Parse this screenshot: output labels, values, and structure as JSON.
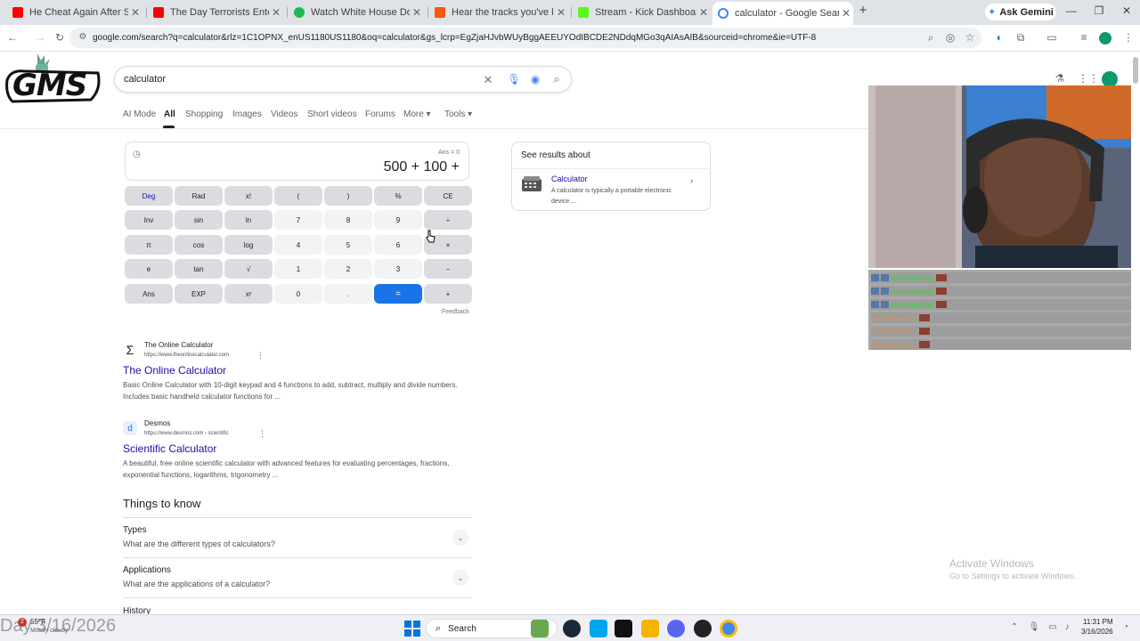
{
  "tabs": [
    {
      "title": "He Cheat Again After She",
      "icon": "youtube-icon",
      "color": "#ff0000"
    },
    {
      "title": "The Day Terrorists Entered the",
      "icon": "youtube-icon",
      "color": "#ff0000"
    },
    {
      "title": "Watch White House Down For",
      "icon": "play-icon",
      "color": "#1db954"
    },
    {
      "title": "Hear the tracks you've liked: on",
      "icon": "soundcloud-icon",
      "color": "#ff5500"
    },
    {
      "title": "Stream - Kick Dashboard",
      "icon": "kick-icon",
      "color": "#53fc18"
    },
    {
      "title": "calculator - Google Search",
      "icon": "google-icon",
      "color": "#4285f4"
    }
  ],
  "gemini_label": "Ask Gemini",
  "url": "google.com/search?q=calculator&rlz=1C1OPNX_enUS1180US1180&oq=calculator&gs_lcrp=EgZjaHJvbWUyBggAEEUYOdIBCDE2NDdqMGo3qAIAsAIB&sourceid=chrome&ie=UTF-8",
  "logo_text": "GMS",
  "search": {
    "query": "calculator"
  },
  "nav_tabs": [
    {
      "label": "AI Mode"
    },
    {
      "label": "All"
    },
    {
      "label": "Shopping"
    },
    {
      "label": "Images"
    },
    {
      "label": "Videos"
    },
    {
      "label": "Short videos"
    },
    {
      "label": "Forums"
    },
    {
      "label": "More ▾"
    },
    {
      "label": "Tools ▾"
    }
  ],
  "calculator": {
    "ans": "Ans = 0",
    "expression": "500 + 100 +",
    "keys": [
      [
        "Deg",
        "Rad",
        "x!",
        "(",
        ")",
        "%",
        "CE"
      ],
      [
        "Inv",
        "sin",
        "ln",
        "7",
        "8",
        "9",
        "÷"
      ],
      [
        "π",
        "cos",
        "log",
        "4",
        "5",
        "6",
        "×"
      ],
      [
        "e",
        "tan",
        "√",
        "1",
        "2",
        "3",
        "−"
      ],
      [
        "Ans",
        "EXP",
        "xʸ",
        "0",
        ".",
        "=",
        "+"
      ]
    ],
    "feedback": "Feedback"
  },
  "results": [
    {
      "site": "The Online Calculator",
      "url": "https://www.theonlinecalculator.com",
      "title": "The Online Calculator",
      "snippet": "Basic Online Calculator with 10-digit keypad and 4 functions to add, subtract, multiply and divide numbers. Includes basic handheld calculator functions for ..."
    },
    {
      "site": "Desmos",
      "url": "https://www.desmos.com › scientific",
      "title": "Scientific Calculator",
      "snippet": "A beautiful, free online scientific calculator with advanced features for evaluating percentages, fractions, exponential functions, logarithms, trigonometry ..."
    }
  ],
  "things_to_know": {
    "title": "Things to know",
    "items": [
      {
        "head": "Types",
        "question": "What are the different types of calculators?"
      },
      {
        "head": "Applications",
        "question": "What are the applications of a calculator?"
      },
      {
        "head": "History",
        "question": ""
      }
    ]
  },
  "side_panel": {
    "heading": "See results about",
    "title": "Calculator",
    "desc": "A calculator is typically a portable electronic device ..."
  },
  "chat": [
    {
      "user": "speakupdvng",
      "color": "#44cc44"
    },
    {
      "user": "speakupdvng",
      "color": "#44cc44"
    },
    {
      "user": "speakupdvng",
      "color": "#44cc44"
    },
    {
      "user": "punkstarmoee",
      "color": "#d89050"
    },
    {
      "user": "punkstarmoee",
      "color": "#d89050"
    },
    {
      "user": "punkstarmoee",
      "color": "#d89050"
    }
  ],
  "activate": {
    "title": "Activate Windows",
    "sub": "Go to Settings to activate Windows."
  },
  "taskbar": {
    "weather_temp": "55°F",
    "weather_desc": "Mostly cloudy",
    "weather_badge": "2",
    "search_label": "Search",
    "time": "11:31 PM",
    "date": "3/16/2026"
  },
  "date_overlay": "Day 3/16/2026"
}
